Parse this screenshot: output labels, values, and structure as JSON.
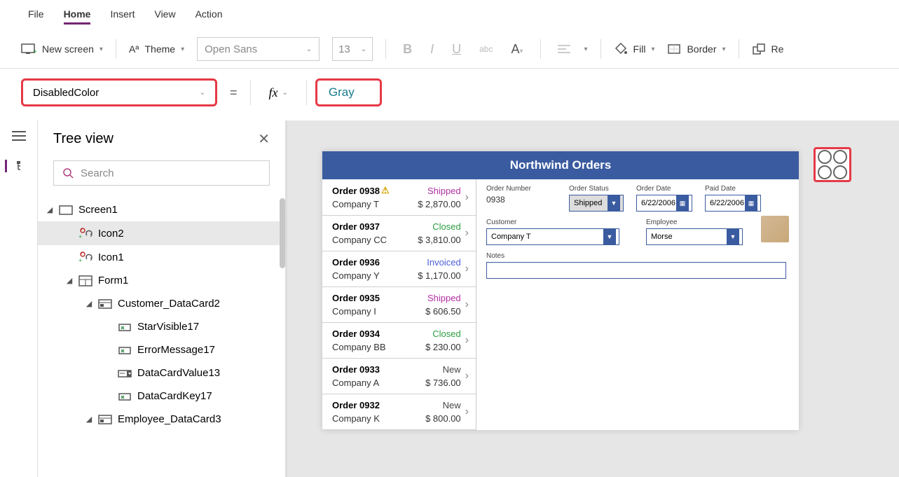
{
  "menu": {
    "items": [
      "File",
      "Home",
      "Insert",
      "View",
      "Action"
    ],
    "active": "Home"
  },
  "ribbon": {
    "new_screen": "New screen",
    "theme": "Theme",
    "font": "Open Sans",
    "font_size": "13",
    "fill": "Fill",
    "border": "Border",
    "re": "Re"
  },
  "property": {
    "name": "DisabledColor",
    "value": "Gray"
  },
  "tree": {
    "title": "Tree view",
    "search_placeholder": "Search",
    "nodes": [
      {
        "label": "Screen1",
        "indent": 0,
        "icon": "screen",
        "collapse": true
      },
      {
        "label": "Icon2",
        "indent": 1,
        "icon": "sync",
        "selected": true
      },
      {
        "label": "Icon1",
        "indent": 1,
        "icon": "sync"
      },
      {
        "label": "Form1",
        "indent": 1,
        "icon": "form",
        "collapse": true
      },
      {
        "label": "Customer_DataCard2",
        "indent": 2,
        "icon": "card",
        "collapse": true
      },
      {
        "label": "StarVisible17",
        "indent": 3,
        "icon": "field"
      },
      {
        "label": "ErrorMessage17",
        "indent": 3,
        "icon": "field"
      },
      {
        "label": "DataCardValue13",
        "indent": 3,
        "icon": "dropdown"
      },
      {
        "label": "DataCardKey17",
        "indent": 3,
        "icon": "field"
      },
      {
        "label": "Employee_DataCard3",
        "indent": 2,
        "icon": "card",
        "collapse": true
      }
    ]
  },
  "app": {
    "title": "Northwind Orders",
    "orders": [
      {
        "id": "Order 0938",
        "warn": true,
        "company": "Company T",
        "status": "Shipped",
        "status_class": "st-shipped",
        "amount": "$ 2,870.00"
      },
      {
        "id": "Order 0937",
        "company": "Company CC",
        "status": "Closed",
        "status_class": "st-closed",
        "amount": "$ 3,810.00"
      },
      {
        "id": "Order 0936",
        "company": "Company Y",
        "status": "Invoiced",
        "status_class": "st-invoiced",
        "amount": "$ 1,170.00"
      },
      {
        "id": "Order 0935",
        "company": "Company I",
        "status": "Shipped",
        "status_class": "st-shipped",
        "amount": "$ 606.50"
      },
      {
        "id": "Order 0934",
        "company": "Company BB",
        "status": "Closed",
        "status_class": "st-closed",
        "amount": "$ 230.00"
      },
      {
        "id": "Order 0933",
        "company": "Company A",
        "status": "New",
        "status_class": "st-new",
        "amount": "$ 736.00"
      },
      {
        "id": "Order 0932",
        "company": "Company K",
        "status": "New",
        "status_class": "st-new",
        "amount": "$ 800.00"
      }
    ],
    "detail": {
      "order_number_label": "Order Number",
      "order_number": "0938",
      "order_status_label": "Order Status",
      "order_status": "Shipped",
      "order_date_label": "Order Date",
      "order_date": "6/22/2006",
      "paid_date_label": "Paid Date",
      "paid_date": "6/22/2006",
      "customer_label": "Customer",
      "customer": "Company T",
      "employee_label": "Employee",
      "employee": "Morse",
      "notes_label": "Notes"
    }
  }
}
